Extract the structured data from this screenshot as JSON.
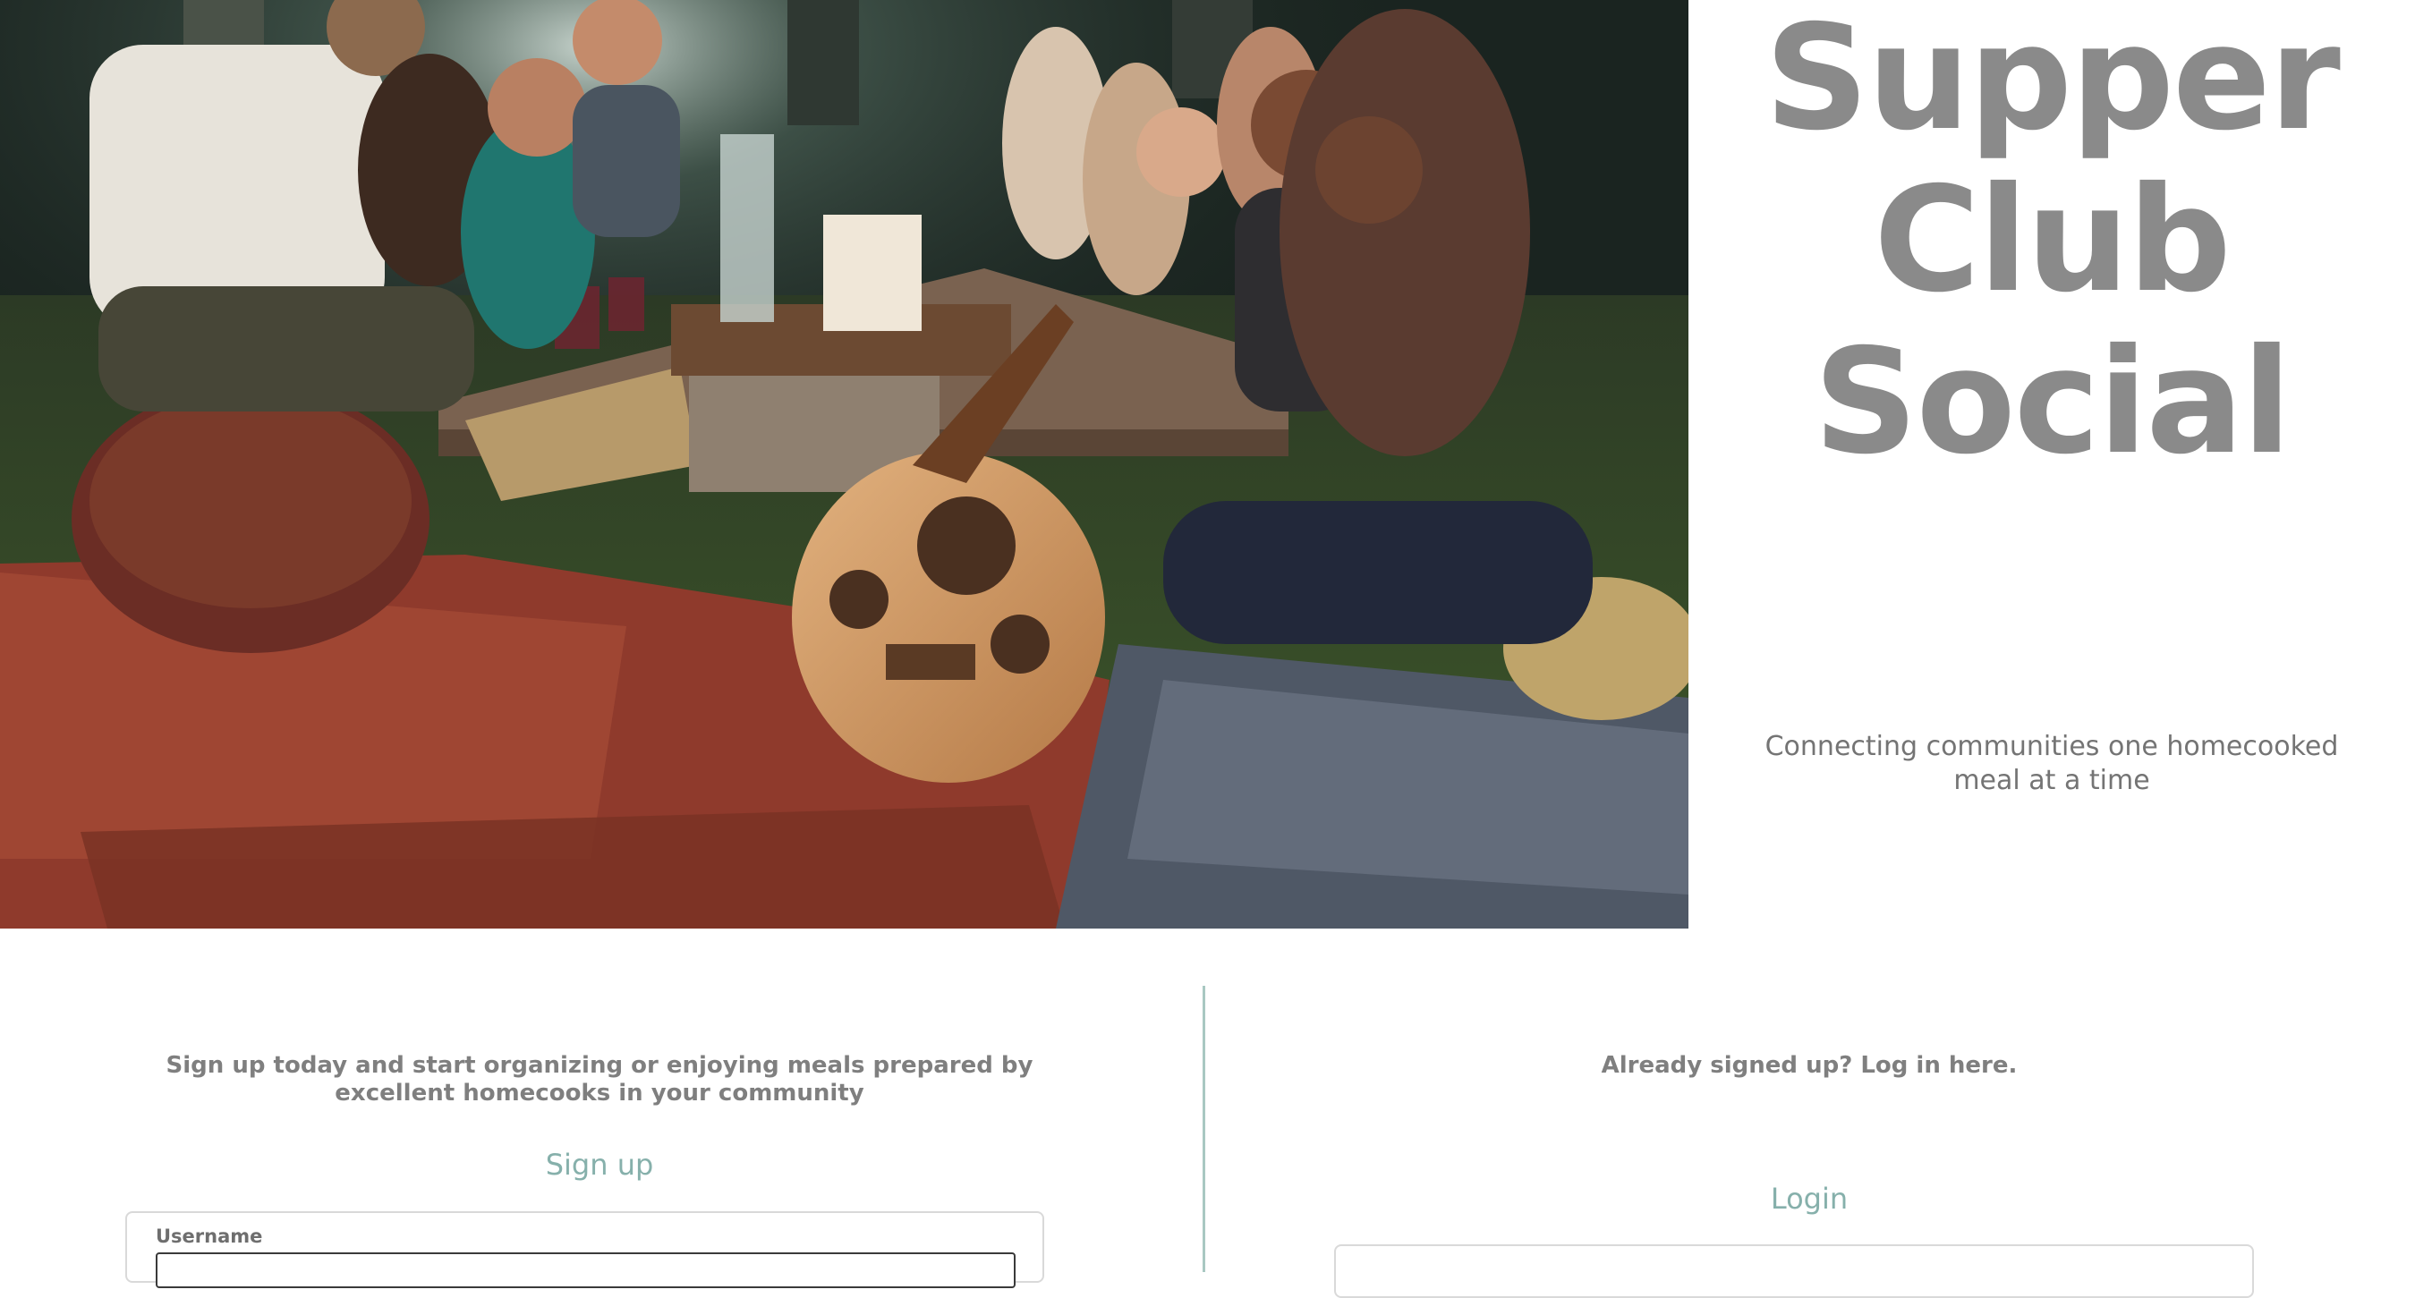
{
  "brand": {
    "title_lines": [
      "Supper",
      "Club",
      "Social"
    ],
    "tagline": "Connecting communities one homecooked meal at a time"
  },
  "signup": {
    "intro": "Sign up today and start organizing or enjoying meals prepared by excellent homecooks in your community",
    "heading": "Sign up",
    "username_label": "Username"
  },
  "login": {
    "intro": "Already signed up? Log in here.",
    "heading": "Login"
  },
  "colors": {
    "title_gray": "#8a8a8a",
    "accent_teal": "#86b0ab",
    "divider_teal": "#a9c8c2",
    "body_gray": "#7f7f7f"
  }
}
